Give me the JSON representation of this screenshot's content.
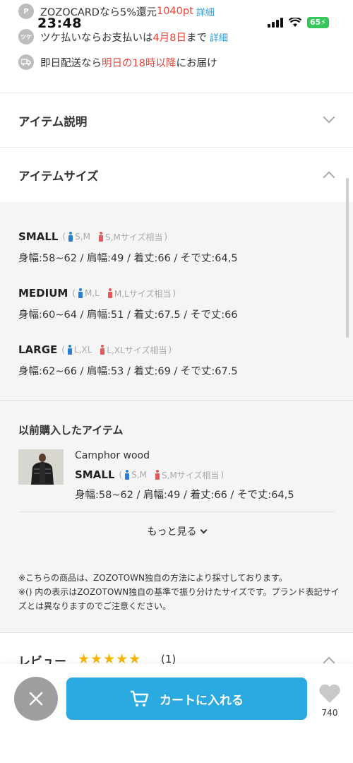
{
  "status_bar": {
    "time": "23:48",
    "battery": "65"
  },
  "info_rows": [
    {
      "icon": "P",
      "parts": [
        {
          "text": "ZOZOCARDなら5%還元 ",
          "style": "normal"
        },
        {
          "text": "1040pt",
          "style": "red"
        }
      ],
      "link": "詳細"
    },
    {
      "icon": "ツケ",
      "parts": [
        {
          "text": "ツケ払いならお支払いは",
          "style": "normal"
        },
        {
          "text": "4月8日",
          "style": "red"
        },
        {
          "text": "まで",
          "style": "normal"
        }
      ],
      "link": "詳細"
    },
    {
      "icon": "truck",
      "parts": [
        {
          "text": "即日配送なら",
          "style": "normal"
        },
        {
          "text": "明日の18時以降",
          "style": "red"
        },
        {
          "text": "にお届け",
          "style": "normal"
        }
      ],
      "link": ""
    }
  ],
  "sections": {
    "description": "アイテム説明",
    "size": "アイテムサイズ"
  },
  "sizes": [
    {
      "name": "SMALL",
      "men": "S,M",
      "women": "S,Mサイズ相当",
      "measure": "身幅:58~62 / 肩幅:49 / 着丈:66 / そで丈:64,5"
    },
    {
      "name": "MEDIUM",
      "men": "M,L",
      "women": "M,Lサイズ相当",
      "measure": "身幅:60~64 / 肩幅:51 / 着丈:67.5 / そで丈:66"
    },
    {
      "name": "LARGE",
      "men": "L,XL",
      "women": "L,XLサイズ相当",
      "measure": "身幅:62~66 / 肩幅:53 / 着丈:69 / そで丈:67.5"
    }
  ],
  "previous": {
    "title": "以前購入したアイテム",
    "brand": "Camphor wood",
    "size": "SMALL",
    "men": "S,M",
    "women": "S,Mサイズ相当",
    "measure": "身幅:58~62 / 肩幅:49 / 着丈:66 / そで丈:64,5",
    "more": "もっと見る"
  },
  "notes": [
    "※こちらの商品は、ZOZOTOWN独自の方法により採寸しております。",
    "※() 内の表示はZOZOTOWN独自の基準で振り分けたサイズです。ブランド表記サイズとは異なりますのでご注意ください。"
  ],
  "review": {
    "label": "レビュー",
    "stars": "★★★★★",
    "count": "(1)"
  },
  "bottom_bar": {
    "cart_label": "カートに入れる",
    "favorite_count": "740"
  },
  "colors": {
    "accent_red": "#e8473b",
    "link_blue": "#2a9bd8",
    "cart_blue": "#2aaae0",
    "star_yellow": "#f5b400"
  }
}
